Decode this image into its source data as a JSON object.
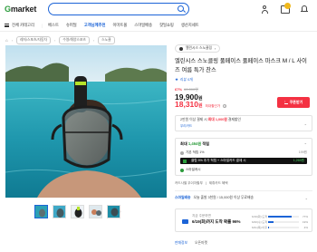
{
  "header": {
    "logo_g": "G",
    "logo_rest": "market",
    "search_placeholder": ""
  },
  "nav": {
    "all_categories": "전체 카테고리",
    "items": [
      "베스트",
      "슈퍼딜",
      "고객님께추천",
      "이마트몰",
      "스마일배송",
      "핫딜쇼핑",
      "생산지세트"
    ]
  },
  "breadcrumbs": {
    "home": "⌂",
    "items": [
      "레저/스포츠/자동차",
      "수영/해양스포츠",
      "스노클"
    ]
  },
  "product": {
    "brand": "엘린시스 스노클링",
    "title": "엘린시스 스노클링 풀페이스 풀페이스 마스크 M / L 사이즈 여름 특가 찬스",
    "rating": "리뷰 0개",
    "discount_pct": "67%",
    "orig_price": "60,000원",
    "price": "19,900",
    "price_unit": "원",
    "coupon_price": "18,310",
    "coupon_unit": "원",
    "coupon_label": "최대할인가",
    "coupon_btn": "쿠폰받기"
  },
  "promo": {
    "line1_prefix": "2만원 이상 결제 시",
    "line1_bold": "최대 1,000원",
    "line1_suffix": "결제할인",
    "line2": "우리카드"
  },
  "points": {
    "label": "최대",
    "amount": "1,464원",
    "suffix": "적립",
    "rows": [
      {
        "text": "기본 적립 1%",
        "right": "199원"
      },
      {
        "text": "클럽 5% 추가 적립 + 스마일카드 결제 시",
        "right": "1,265원"
      },
      {
        "text": "스마일캐시",
        "right": ""
      }
    ]
  },
  "card_info": [
    "카드사별 무이자할부",
    "제휴카드 혜택"
  ],
  "shipping": {
    "tag": "스마일배송",
    "text": "오늘 출발 3천원 / 15,000원 이상 무료배송"
  },
  "delivery_stats": {
    "header": "지금 주문하면",
    "title": "6/19(화)까지 도착 확률 96%",
    "bars": [
      {
        "label": "6/19(화) 도착",
        "pct": 0.77,
        "text": "77%"
      },
      {
        "label": "6/20(수) 도착",
        "pct": 0.19,
        "text": "19%"
      },
      {
        "label": "6/21(목) 이후",
        "pct": 0.04,
        "text": "4%"
      }
    ]
  },
  "footer": {
    "a": "판매정보",
    "b": "오픈마켓"
  }
}
